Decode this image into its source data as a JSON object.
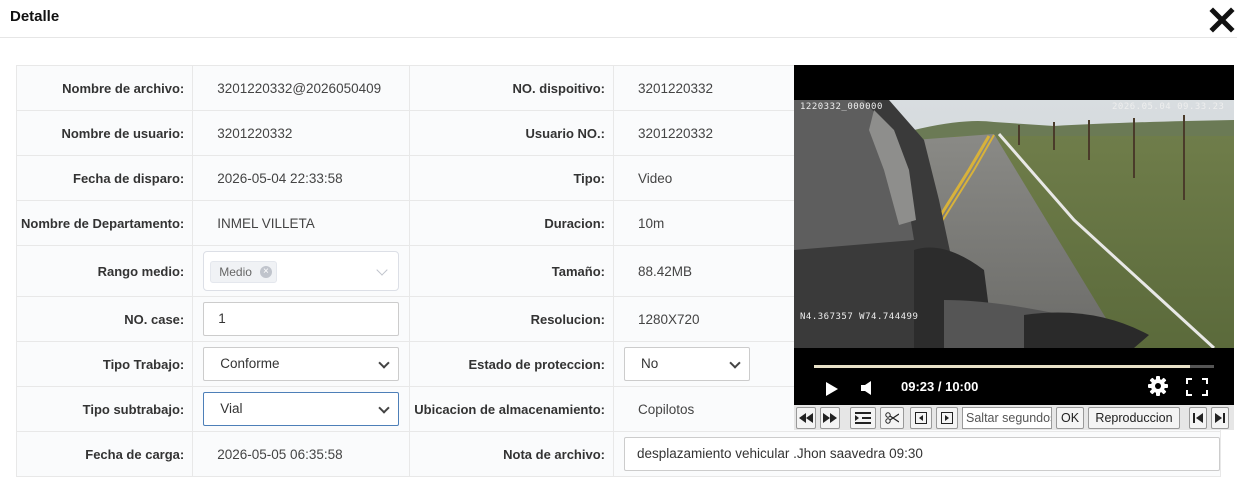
{
  "header": {
    "title": "Detalle"
  },
  "fields": {
    "nombre_archivo_label": "Nombre de archivo:",
    "nombre_archivo_value": "3201220332@2026050409",
    "no_dispositivo_label": "NO. dispoitivo:",
    "no_dispositivo_value": "3201220332",
    "nombre_usuario_label": "Nombre de usuario:",
    "nombre_usuario_value": "3201220332",
    "usuario_no_label": "Usuario NO.:",
    "usuario_no_value": "3201220332",
    "fecha_disparo_label": "Fecha de disparo:",
    "fecha_disparo_value": "2026-05-04 22:33:58",
    "tipo_label": "Tipo:",
    "tipo_value": "Video",
    "departamento_label": "Nombre de Departamento:",
    "departamento_value": "INMEL VILLETA",
    "duracion_label": "Duracion:",
    "duracion_value": "10m",
    "rango_medio_label": "Rango medio:",
    "rango_medio_tag": "Medio",
    "tamano_label": "Tamaño:",
    "tamano_value": "88.42MB",
    "no_case_label": "NO. case:",
    "no_case_value": "1",
    "resolucion_label": "Resolucion:",
    "resolucion_value": "1280X720",
    "tipo_trabajo_label": "Tipo Trabajo:",
    "tipo_trabajo_value": "Conforme",
    "estado_proteccion_label": "Estado de proteccion:",
    "estado_proteccion_value": "No",
    "tipo_subtrabajo_label": "Tipo subtrabajo:",
    "tipo_subtrabajo_value": "Vial",
    "ubicacion_label": "Ubicacion de almacenamiento:",
    "ubicacion_value": "Copilotos",
    "fecha_carga_label": "Fecha de carga:",
    "fecha_carga_value": "2026-05-05 06:35:58",
    "nota_label": "Nota de archivo:",
    "nota_value": "desplazamiento vehicular .Jhon saavedra 09:30"
  },
  "video": {
    "osd_device": "1220332_000000",
    "osd_datetime": "2026.05.04 09.33.23",
    "osd_gps": "N4.367357 W74.744499",
    "time_display": "09:23 / 10:00",
    "progress": 0.94
  },
  "toolbar": {
    "jump_placeholder": "Saltar segundos",
    "ok_label": "OK",
    "playback_label": "Reproduccion"
  },
  "colors": {
    "progress": "#e8e1c8",
    "focus_border": "#4d7fb8"
  }
}
